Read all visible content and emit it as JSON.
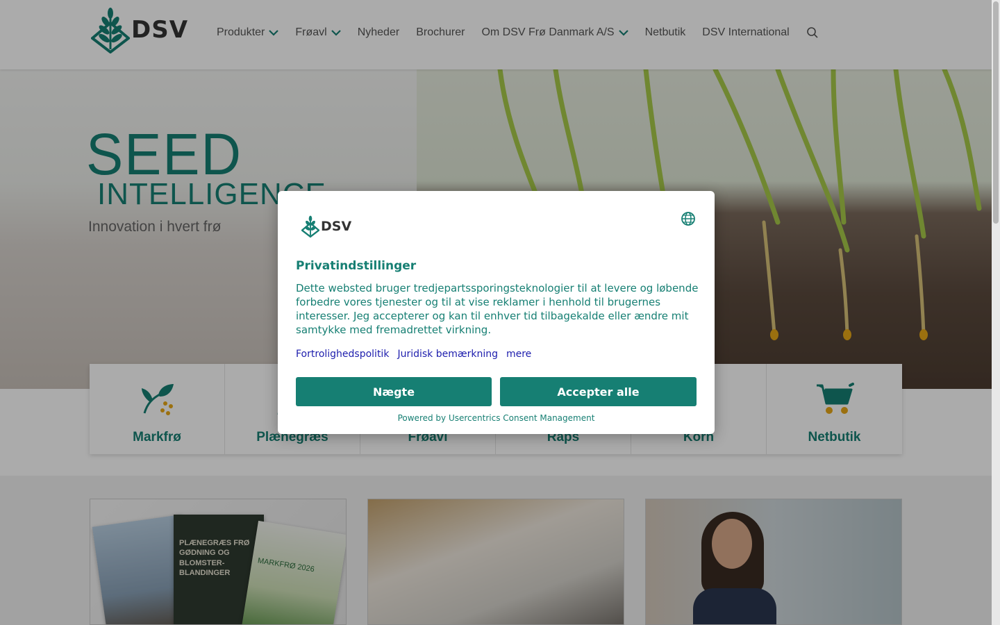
{
  "header": {
    "logo_text": "DSV",
    "nav": [
      {
        "label": "Produkter",
        "has_dropdown": true
      },
      {
        "label": "Frøavl",
        "has_dropdown": true
      },
      {
        "label": "Nyheder",
        "has_dropdown": false
      },
      {
        "label": "Brochurer",
        "has_dropdown": false
      },
      {
        "label": "Om DSV Frø Danmark A/S",
        "has_dropdown": true
      },
      {
        "label": "Netbutik",
        "has_dropdown": false
      },
      {
        "label": "DSV International",
        "has_dropdown": false
      }
    ],
    "search_icon": "search-icon"
  },
  "hero": {
    "title": "SEED",
    "subtitle": "INTELLIGENCE",
    "tagline": "Innovation i hvert frø"
  },
  "categories": [
    {
      "label": "Markfrø",
      "icon": "sprout-seeds-icon"
    },
    {
      "label": "Plænegræs",
      "icon": "grass-icon"
    },
    {
      "label": "Frøavl",
      "icon": "seed-icon"
    },
    {
      "label": "Raps",
      "icon": "rapeseed-icon"
    },
    {
      "label": "Korn",
      "icon": "grain-icon"
    },
    {
      "label": "Netbutik",
      "icon": "shopping-cart-icon"
    }
  ],
  "cards": {
    "brochure_titles": [
      "PLÆNEGRÆS FRØ GØDNING OG BLOMSTER-BLANDINGER",
      "MARKFRØ 2026"
    ]
  },
  "consent": {
    "logo_text": "DSV",
    "title": "Privatindstillinger",
    "body": "Dette websted bruger tredjepartssporingsteknologier til at levere og løbende forbedre vores tjenester og til at vise reklamer i henhold til brugernes interesser. Jeg accepterer og kan til enhver tid tilbagekalde eller ændre mit samtykke med fremadrettet virkning.",
    "links": [
      "Fortrolighedspolitik",
      "Juridisk bemærkning",
      "mere"
    ],
    "deny_label": "Nægte",
    "accept_label": "Accepter alle",
    "powered_by": "Powered by Usercentrics Consent Management"
  },
  "colors": {
    "brand": "#167f73",
    "link": "#1d1dad",
    "accent_seed": "#e8a817"
  }
}
